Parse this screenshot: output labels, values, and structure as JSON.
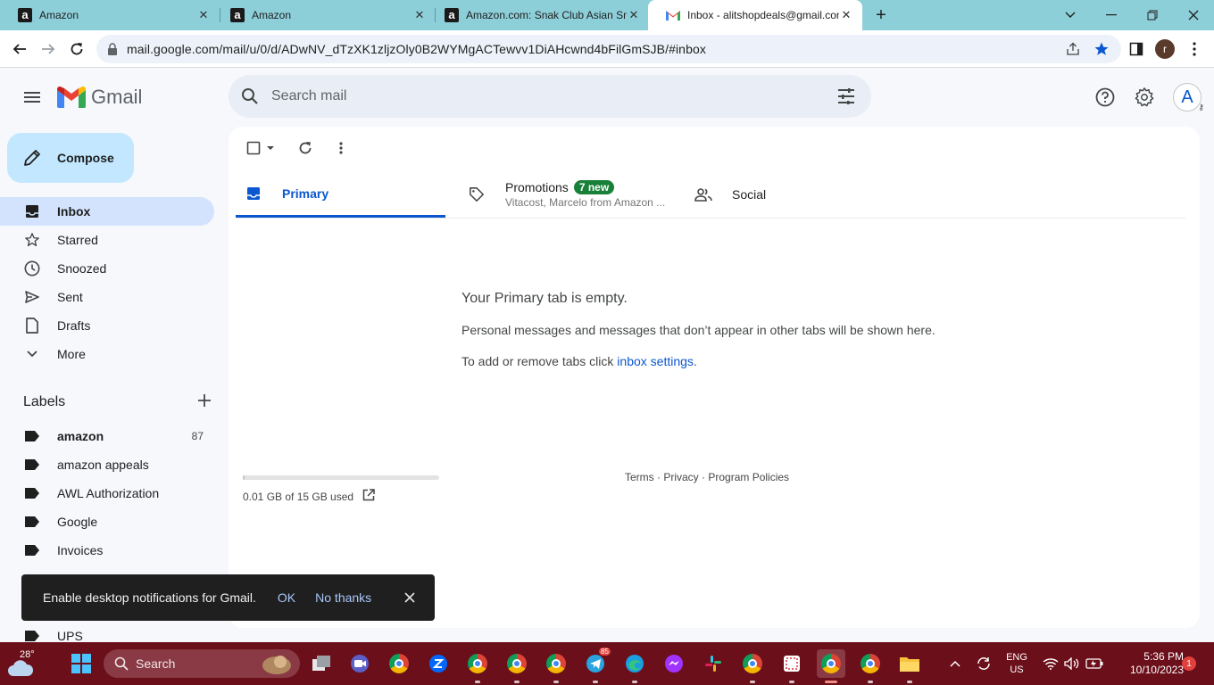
{
  "browser": {
    "tabs": [
      {
        "title": "Amazon",
        "favicon": "amazon-favicon"
      },
      {
        "title": "Amazon",
        "favicon": "amazon-favicon"
      },
      {
        "title": "Amazon.com: Snak Club Asian Sn",
        "favicon": "amazon-favicon"
      },
      {
        "title": "Inbox - alitshopdeals@gmail.com",
        "favicon": "gmail-favicon",
        "active": true
      }
    ],
    "url": "mail.google.com/mail/u/0/d/ADwNV_dTzXK1zljzOly0B2WYMgACTewvv1DiAHcwnd4bFilGmSJB/#inbox",
    "profile_initial": "r"
  },
  "gmail": {
    "wordmark": "Gmail",
    "search_placeholder": "Search mail",
    "account_initial": "A",
    "compose_label": "Compose",
    "nav": [
      {
        "label": "Inbox",
        "icon": "inbox-icon",
        "active": true
      },
      {
        "label": "Starred",
        "icon": "star-icon"
      },
      {
        "label": "Snoozed",
        "icon": "clock-icon"
      },
      {
        "label": "Sent",
        "icon": "send-icon"
      },
      {
        "label": "Drafts",
        "icon": "draft-icon"
      },
      {
        "label": "More",
        "icon": "chevron-down-icon"
      }
    ],
    "labels_title": "Labels",
    "labels": [
      {
        "name": "amazon",
        "count": "87",
        "bold": true
      },
      {
        "name": "amazon appeals"
      },
      {
        "name": "AWL Authorization"
      },
      {
        "name": "Google"
      },
      {
        "name": "Invoices"
      },
      {
        "name": "UPS"
      }
    ],
    "tabs": {
      "primary": "Primary",
      "promotions": "Promotions",
      "promotions_badge": "7 new",
      "promotions_sub": "Vitacost, Marcelo from Amazon ...",
      "social": "Social"
    },
    "empty": {
      "title": "Your Primary tab is empty.",
      "line1": "Personal messages and messages that don’t appear in other tabs will be shown here.",
      "line2_prefix": "To add or remove tabs click ",
      "line2_link": "inbox settings",
      "line2_suffix": "."
    },
    "storage": {
      "text": "0.01 GB of 15 GB used",
      "used_fraction": 0.0007
    },
    "footer": {
      "terms": "Terms",
      "privacy": "Privacy",
      "policies": "Program Policies",
      "sep": " · "
    },
    "snackbar": {
      "message": "Enable desktop notifications for Gmail.",
      "ok": "OK",
      "no_thanks": "No thanks"
    }
  },
  "taskbar": {
    "temperature": "28°",
    "search_label": "Search",
    "lang_top": "ENG",
    "lang_bottom": "US",
    "time": "5:36 PM",
    "date": "10/10/2023",
    "notification_count": "1",
    "telegram_badge": "85"
  },
  "colors": {
    "tabstrip": "#8dcfd9",
    "accent": "#0b57d0",
    "compose": "#c2e7ff",
    "nav_active": "#d3e3fd",
    "badge_green": "#188038",
    "taskbar": "#6b0f1a"
  }
}
